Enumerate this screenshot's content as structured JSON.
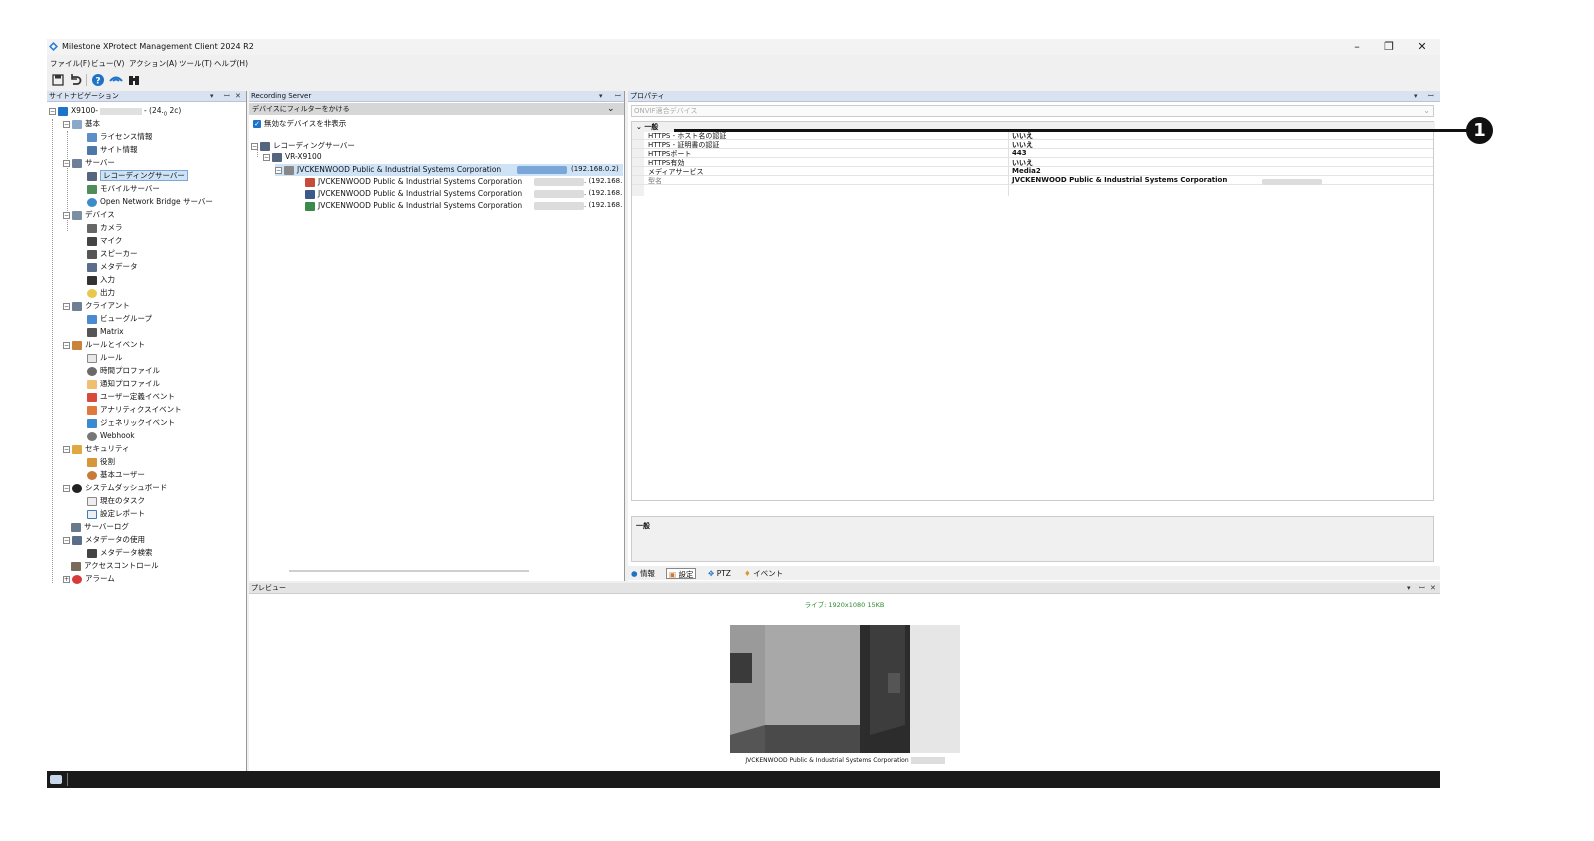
{
  "window": {
    "title": "Milestone XProtect Management Client 2024 R2",
    "controls": {
      "minimize": "–",
      "maximize": "❐",
      "close": "✕"
    }
  },
  "menu": [
    "ファイル(F)",
    "ビュー(V)",
    "アクション(A)",
    "ツール(T)",
    "ヘルプ(H)"
  ],
  "toolbar": [
    "save-icon",
    "undo-icon",
    "help-icon",
    "connect-icon",
    "binoculars-icon"
  ],
  "site_nav": {
    "title": "サイトナビゲーション",
    "root": "X9100-",
    "root_suffix": "- (24.",
    "root_suffix_sub": "0",
    "root_suffix_end": " 2c)",
    "items": {
      "basic": "基本",
      "license": "ライセンス情報",
      "site_info": "サイト情報",
      "servers": "サーバー",
      "recording_servers": "レコーディングサーバー",
      "mobile_servers": "モバイルサーバー",
      "open_network_bridge": "Open Network Bridge サーバー",
      "devices": "デバイス",
      "cameras": "カメラ",
      "microphones": "マイク",
      "speakers": "スピーカー",
      "metadata": "メタデータ",
      "input": "入力",
      "output": "出力",
      "clients": "クライアント",
      "view_groups": "ビューグループ",
      "matrix": "Matrix",
      "rules_events": "ルールとイベント",
      "rules": "ルール",
      "time_profiles": "時間プロファイル",
      "notification_profiles": "通知プロファイル",
      "user_defined_events": "ユーザー定義イベント",
      "analytics_events": "アナリティクスイベント",
      "generic_events": "ジェネリックイベント",
      "webhook": "Webhook",
      "security": "セキュリティ",
      "roles": "役割",
      "basic_users": "基本ユーザー",
      "system_dashboard": "システムダッシュボード",
      "current_tasks": "現在のタスク",
      "config_report": "設定レポート",
      "server_logs": "サーバーログ",
      "metadata_use": "メタデータの使用",
      "metadata_search": "メタデータ検索",
      "access_control": "アクセスコントロール",
      "alarms": "アラーム"
    }
  },
  "recording_server": {
    "title": "Recording Server",
    "filter_label": "デバイスにフィルターをかける",
    "hide_disabled": "無効なデバイスを非表示",
    "tree_root": "レコーディングサーバー",
    "server": "VR-X9100",
    "devices": [
      {
        "name": "JVCKENWOOD Public & Industrial Systems Corporation",
        "ip": "(192.168.0.2)"
      },
      {
        "name": "JVCKENWOOD Public & Industrial Systems Corporation",
        "ip": ". (192.168."
      },
      {
        "name": "JVCKENWOOD Public & Industrial Systems Corporation",
        "ip": ". (192.168."
      },
      {
        "name": "JVCKENWOOD Public & Industrial Systems Corporation",
        "ip": ". (192.168."
      }
    ]
  },
  "properties": {
    "title": "プロパティ",
    "device_select": "ONVIF適合デバイス",
    "category": "一般",
    "rows": [
      {
        "name": "HTTPS - ホスト名の認証",
        "value": "いいえ"
      },
      {
        "name": "HTTPS - 証明書の認証",
        "value": "いいえ"
      },
      {
        "name": "HTTPSポート",
        "value": "443"
      },
      {
        "name": "HTTPS有効",
        "value": "いいえ"
      },
      {
        "name": "メディアサービス",
        "value": "Media2"
      },
      {
        "name": "型名",
        "value": "JVCKENWOOD Public & Industrial Systems Corporation"
      }
    ],
    "description_title": "一般",
    "tabs": [
      "情報",
      "設定",
      "PTZ",
      "イベント"
    ]
  },
  "preview": {
    "title": "プレビュー",
    "live_info": "ライブ: 1920x1080 15KB",
    "caption": "JVCKENWOOD Public & Industrial Systems Corporation"
  },
  "callout": {
    "number": "1"
  },
  "colors": {
    "header": "#d8e2f0",
    "selection": "#cfe3f6",
    "accent": "#1e73c8",
    "status_bar": "#1a1a1a"
  }
}
